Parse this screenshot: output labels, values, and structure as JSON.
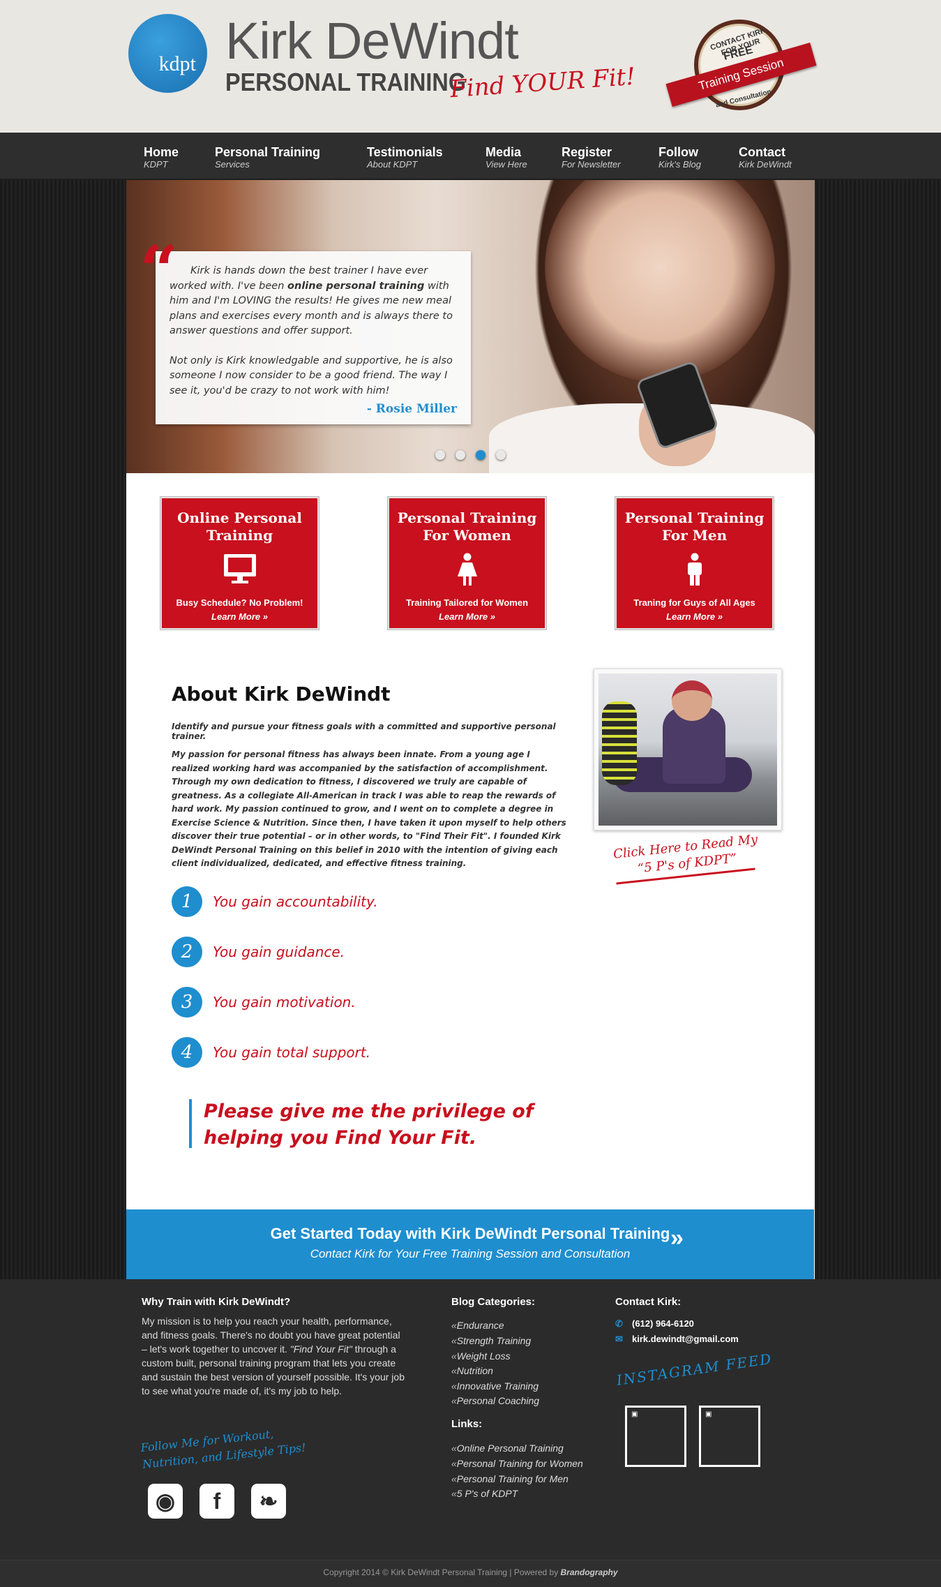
{
  "header": {
    "logo_text": "kdpt",
    "brand_name": "Kirk DeWindt",
    "brand_sub": "PERSONAL TRAINING",
    "tagline": "Find YOUR Fit!",
    "badge": {
      "top": "CONTACT KIRK FOR YOUR",
      "free": "FREE",
      "ribbon": "Training Session",
      "bottom": "and Consultation"
    }
  },
  "nav": [
    {
      "title": "Home",
      "sub": "KDPT"
    },
    {
      "title": "Personal Training",
      "sub": "Services"
    },
    {
      "title": "Testimonials",
      "sub": "About KDPT"
    },
    {
      "title": "Media",
      "sub": "View Here"
    },
    {
      "title": "Register",
      "sub": "For Newsletter"
    },
    {
      "title": "Follow",
      "sub": "Kirk's Blog"
    },
    {
      "title": "Contact",
      "sub": "Kirk DeWindt"
    }
  ],
  "hero": {
    "quote_mark": "“",
    "paragraph1_a": "Kirk is hands down the best trainer I have ever worked with. I've been ",
    "paragraph1_b": "online personal training",
    "paragraph1_c": " with him and I'm LOVING the results! He gives me new meal plans and exercises every month and is always there to answer questions and offer support.",
    "paragraph2": "Not only is Kirk knowledgable and supportive, he is also someone I now consider to be a good friend. The way I see it, you'd be crazy to not work with him!",
    "author": "- Rosie Miller",
    "slide_count": 4,
    "active_slide": 3
  },
  "services": [
    {
      "title": "Online Personal Training",
      "icon": "monitor-icon",
      "desc": "Busy Schedule? No Problem!",
      "more": "Learn More »"
    },
    {
      "title": "Personal Training For Women",
      "icon": "woman-icon",
      "desc": "Training Tailored for Women",
      "more": "Learn More »"
    },
    {
      "title": "Personal Training For Men",
      "icon": "man-icon",
      "desc": "Traning for Guys of All Ages",
      "more": "Learn More »"
    }
  ],
  "about": {
    "title": "About Kirk DeWindt",
    "lead": "Identify and pursue your fitness goals with a committed and supportive personal trainer.",
    "body": "My passion for personal fitness has always been innate. From a young age I realized working hard was accompanied by the satisfaction of accomplishment. Through my own dedication to fitness, I discovered we truly are capable of greatness. As a collegiate All-American in track I was able to reap the rewards of hard work. My passion continued to grow, and I went on to complete a degree in Exercise Science & Nutrition. Since then, I have taken it upon myself to help others discover their true potential – or in other words, to \"Find Their Fit\". I founded Kirk DeWindt Personal Training on this belief in 2010 with the intention of giving each client individualized, dedicated, and effective fitness training.",
    "click_read": "Click Here to Read My “5 P's of KDPT”"
  },
  "benefits": [
    {
      "num": "1",
      "text": "You gain accountability."
    },
    {
      "num": "2",
      "text": "You gain guidance."
    },
    {
      "num": "3",
      "text": "You gain motivation."
    },
    {
      "num": "4",
      "text": "You gain total support."
    }
  ],
  "pledge": "Please give me the privilege of helping you Find Your Fit.",
  "cta": {
    "title": "Get Started Today with Kirk DeWindt Personal Training",
    "sub": "Contact Kirk for Your Free Training Session and Consultation",
    "arrow": "»"
  },
  "footer": {
    "why_title": "Why Train with Kirk DeWindt?",
    "why_a": "My mission is to help you reach your health, performance, and fitness goals. There's no doubt you have great potential – let's work together to uncover it. ",
    "why_b": "\"Find Your Fit\"",
    "why_c": " through a custom built, personal training program that lets you create and sustain the best version of yourself possible. It's your job to see what you're made of, it's my job to help.",
    "follow_script": "Follow Me for Workout, Nutrition, and Lifestyle Tips!",
    "social": [
      {
        "icon": "instagram-icon",
        "glyph": "◉"
      },
      {
        "icon": "facebook-icon",
        "glyph": "f"
      },
      {
        "icon": "twitter-icon",
        "glyph": "❧"
      }
    ],
    "blog_title": "Blog Categories:",
    "blog_categories": [
      "Endurance",
      "Strength Training",
      "Weight Loss",
      "Nutrition",
      "Innovative Training",
      "Personal Coaching"
    ],
    "links_title": "Links:",
    "links": [
      "Online Personal Training",
      "Personal Training for Women",
      "Personal Training for Men",
      "5 P's of KDPT"
    ],
    "contact_title": "Contact Kirk:",
    "phone_icon": "phone-icon",
    "phone": "(612) 964-6120",
    "email_icon": "email-icon",
    "email": "kirk.dewindt@gmail.com",
    "instagram_title": "INSTAGRAM FEED",
    "copyright_a": "Copyright 2014 © Kirk DeWindt Personal Training | Powered by ",
    "copyright_b": "Brandography"
  },
  "colors": {
    "brand_red": "#c8101e",
    "brand_blue": "#1e8ecf",
    "nav_bg": "#2e2e2e",
    "footer_bg": "#2b2b2b"
  }
}
